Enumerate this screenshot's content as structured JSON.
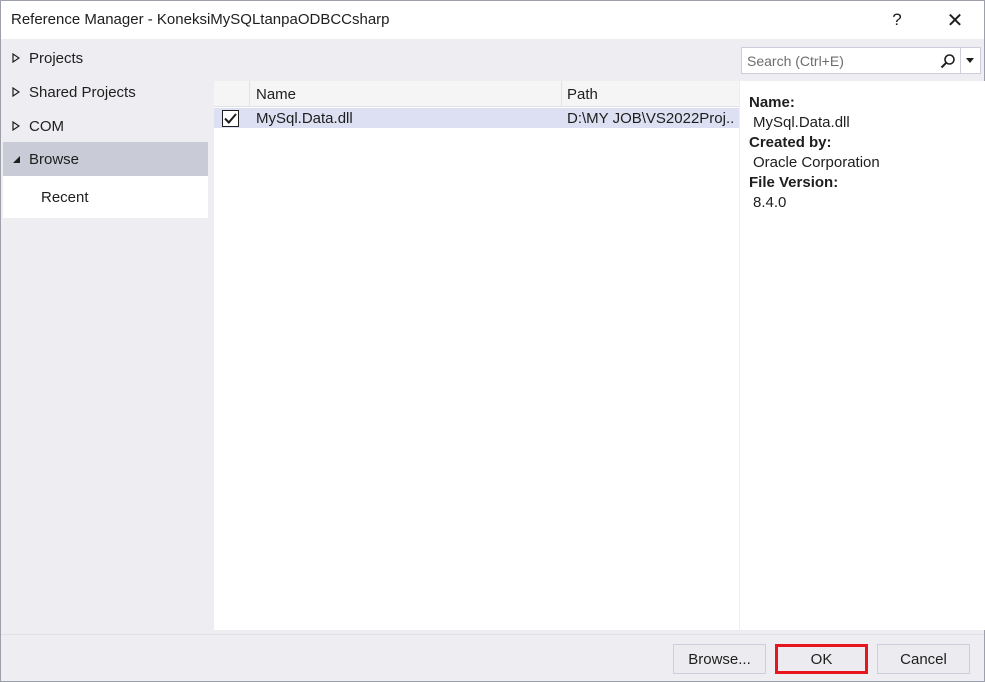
{
  "window": {
    "title": "Reference Manager - KoneksiMySQLtanpaODBCCsharp",
    "help_glyph": "?",
    "close_glyph": "✕"
  },
  "nav": {
    "items": [
      {
        "label": "Projects",
        "expanded": false
      },
      {
        "label": "Shared Projects",
        "expanded": false
      },
      {
        "label": "COM",
        "expanded": false
      },
      {
        "label": "Browse",
        "expanded": true,
        "selected": true
      }
    ],
    "sub_items": [
      {
        "label": "Recent"
      }
    ]
  },
  "search": {
    "placeholder": "Search (Ctrl+E)"
  },
  "list": {
    "columns": {
      "name": "Name",
      "path": "Path"
    },
    "rows": [
      {
        "checked": true,
        "name": "MySql.Data.dll",
        "path": "D:\\MY JOB\\VS2022Proj..."
      }
    ]
  },
  "details": {
    "name_label": "Name:",
    "name_value": "MySql.Data.dll",
    "created_label": "Created by:",
    "created_value": "Oracle Corporation",
    "version_label": "File Version:",
    "version_value": "8.4.0"
  },
  "buttons": {
    "browse": "Browse...",
    "ok": "OK",
    "cancel": "Cancel"
  },
  "colors": {
    "selected_row": "#dde0f2",
    "highlight_border": "#e8141e",
    "nav_selected": "#c9ccd6"
  },
  "icons": {
    "search": "search-icon",
    "dropdown": "chevron-down-icon",
    "expand": "triangle-right-icon",
    "collapse": "triangle-down-icon",
    "check": "checkmark-icon"
  }
}
